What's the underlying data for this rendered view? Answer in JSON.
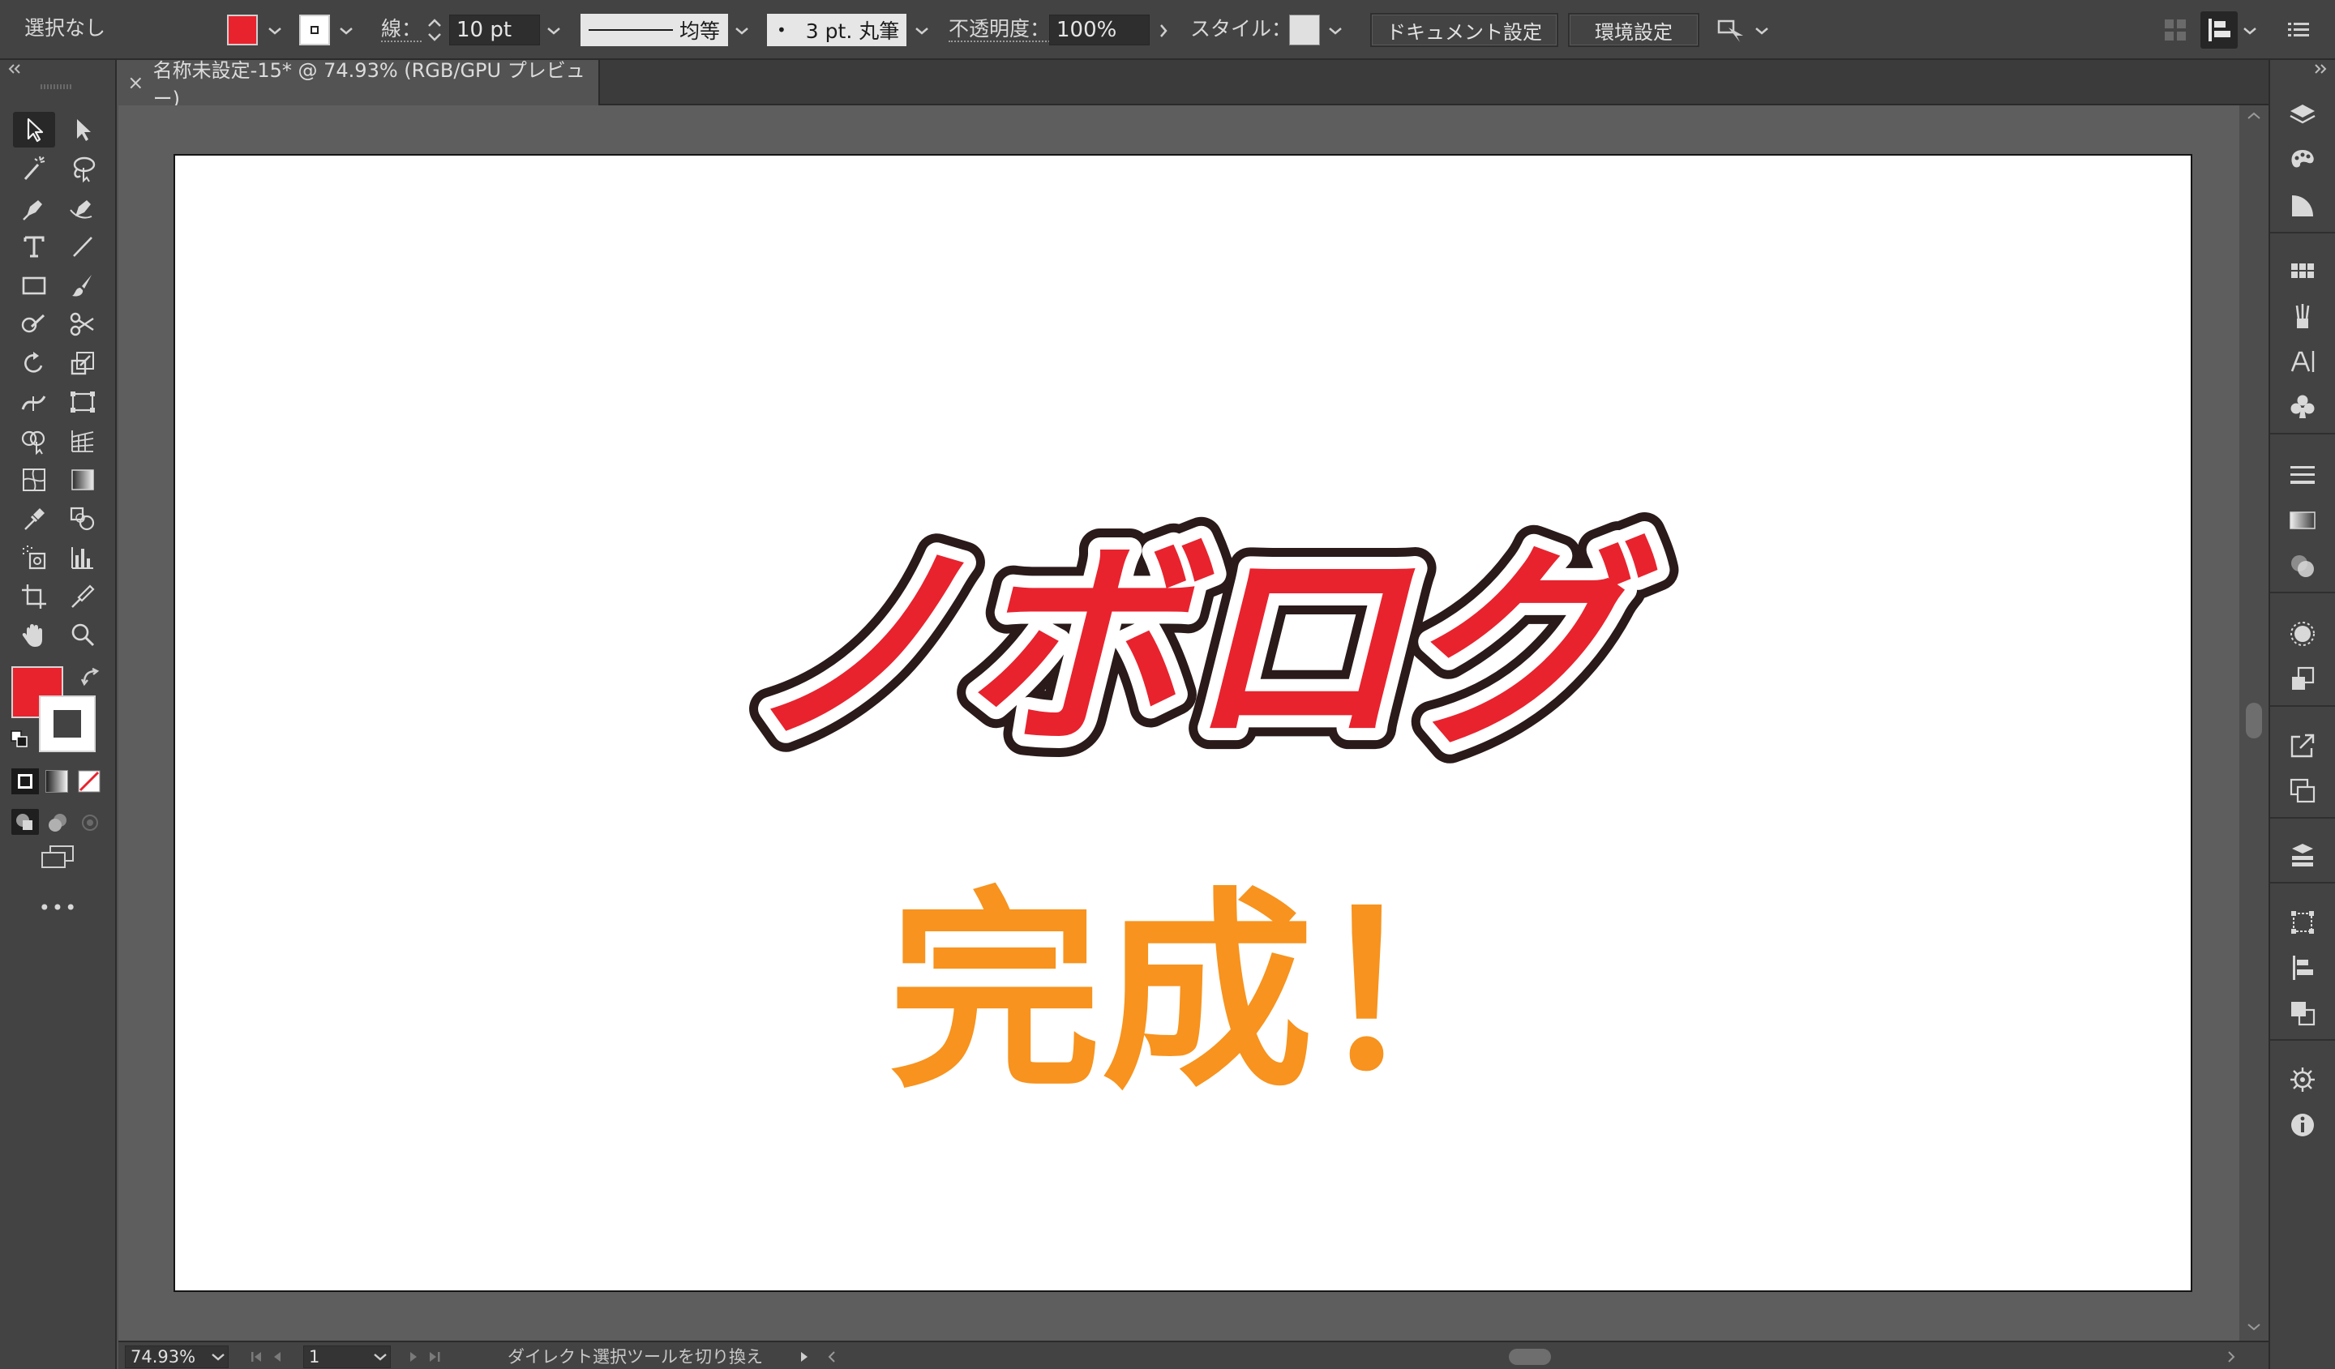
{
  "control_bar": {
    "selection_status": "選択なし",
    "fill_color": "#e8232e",
    "stroke_label": "線：",
    "stroke_weight": "10 pt",
    "stroke_profile": "均等",
    "brush": "3 pt. 丸筆",
    "opacity_label": "不透明度：",
    "opacity_value": "100%",
    "style_label": "スタイル：",
    "document_settings_button": "ドキュメント設定",
    "preferences_button": "環境設定"
  },
  "document_tab": {
    "close_glyph": "×",
    "title": "名称未設定-15* @ 74.93% (RGB/GPU プレビュー)"
  },
  "artboard": {
    "headline": "ノボログ",
    "subheadline": "完成！",
    "headline_fill": "#e8232e",
    "headline_outline": "#2a1a1a",
    "subheadline_color": "#f7931e"
  },
  "toolbar": {
    "fill_color": "#e8232e",
    "stroke_color": "#ffffff",
    "more_tools": "•••"
  },
  "status_bar": {
    "zoom": "74.93%",
    "page": "1",
    "current_tool": "ダイレクト選択ツールを切り換え"
  }
}
